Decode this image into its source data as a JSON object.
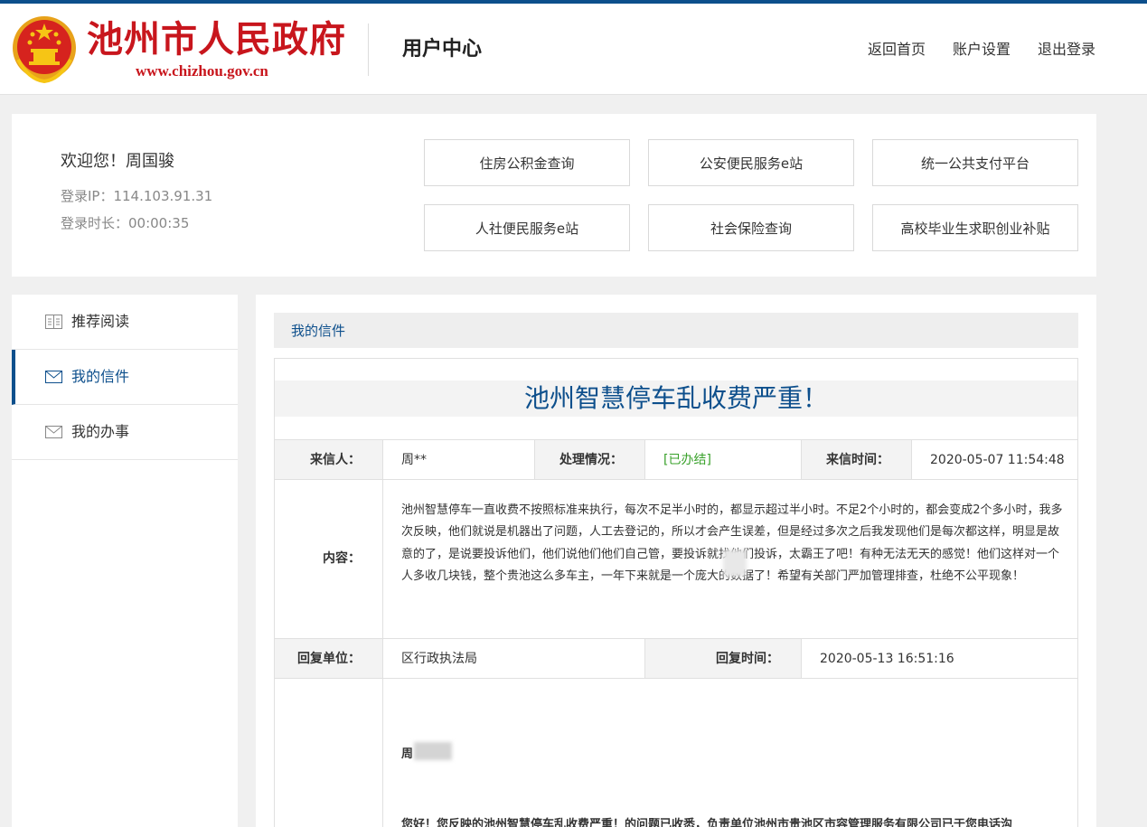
{
  "header": {
    "site_name": "池州市人民政府",
    "site_url": "www.chizhou.gov.cn",
    "section_title": "用户中心",
    "nav": {
      "home": "返回首页",
      "settings": "账户设置",
      "logout": "退出登录"
    },
    "brand_color": "#c8161d",
    "accent_color": "#0d4f8c"
  },
  "user": {
    "welcome": "欢迎您！周国骏",
    "login_ip": "登录IP：114.103.91.31",
    "login_duration": "登录时长：00:00:35"
  },
  "services": [
    "住房公积金查询",
    "公安便民服务e站",
    "统一公共支付平台",
    "人社便民服务e站",
    "社会保险查询",
    "高校毕业生求职创业补贴"
  ],
  "sidebar": {
    "items": [
      {
        "label": "推荐阅读",
        "icon": "book-icon",
        "active": false
      },
      {
        "label": "我的信件",
        "icon": "mail-icon",
        "active": true
      },
      {
        "label": "我的办事",
        "icon": "mail-icon",
        "active": false
      }
    ]
  },
  "breadcrumb": "我的信件",
  "letter": {
    "title": "池州智慧停车乱收费严重！",
    "sender_label": "来信人：",
    "sender": "周**",
    "status_label": "处理情况：",
    "status": "[已办结]",
    "status_color": "#38a12a",
    "time_label": "来信时间：",
    "time": "2020-05-07 11:54:48",
    "content_label": "内容：",
    "content": "池州智慧停车一直收费不按照标准来执行，每次不足半小时的，都显示超过半小时。不足2个小时的，都会变成2个多小时，我多次反映，他们就说是机器出了问题，人工去登记的，所以才会产生误差，但是经过多次之后我发现他们是每次都这样，明显是故意的了，是说要投诉他们，他们说他们他们自己管，要投诉就找他们投诉，太霸王了吧！有种无法无天的感觉！他们这样对一个人多收几块钱，整个贵池这么多车主，一年下来就是一个庞大的数据了！希望有关部门严加管理排查，杜绝不公平现象！",
    "reply_unit_label": "回复单位：",
    "reply_unit": "区行政执法局",
    "reply_time_label": "回复时间：",
    "reply_time": "2020-05-13 16:51:16",
    "reply_salutation": "周",
    "reply_body": "您好！您反映的池州智慧停车乱收费严重！的问题已收悉，负责单位池州市贵池区市容管理服务有限公司已于您电话沟"
  }
}
